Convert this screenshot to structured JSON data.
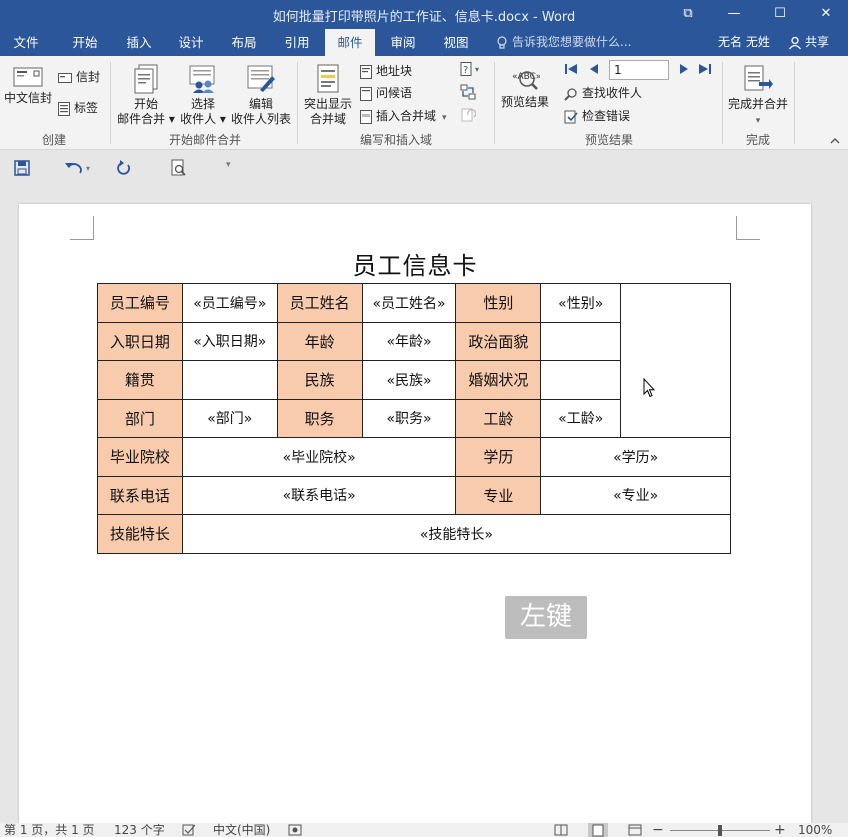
{
  "window": {
    "title": "如何批量打印带照片的工作证、信息卡.docx - Word",
    "controls": {
      "help": "⧉",
      "minimize": "—",
      "maximize": "☐",
      "close": "✕"
    }
  },
  "tabs": [
    {
      "label": "文件"
    },
    {
      "label": "开始"
    },
    {
      "label": "插入"
    },
    {
      "label": "设计"
    },
    {
      "label": "布局"
    },
    {
      "label": "引用"
    },
    {
      "label": "邮件",
      "active": true
    },
    {
      "label": "审阅"
    },
    {
      "label": "视图"
    }
  ],
  "tell_me": "告诉我您想要做什么...",
  "user": "无名 无姓",
  "share": "共享",
  "ribbon": {
    "create": {
      "label": "创建",
      "chinese_envelope": "中文信封",
      "envelope": "信封",
      "labels": "标签"
    },
    "start_merge": {
      "label": "开始邮件合并",
      "start": [
        "开始",
        "邮件合并 ▾"
      ],
      "select": [
        "选择",
        "收件人 ▾"
      ],
      "edit": [
        "编辑",
        "收件人列表"
      ]
    },
    "write_insert": {
      "label": "编写和插入域",
      "highlight": [
        "突出显示",
        "合并域"
      ],
      "address_block": "地址块",
      "greeting": "问候语",
      "insert_field": "插入合并域"
    },
    "preview": {
      "label": "预览结果",
      "preview_results": "预览结果",
      "record": "1",
      "find_recipient": "查找收件人",
      "check_errors": "检查错误"
    },
    "finish": {
      "label": "完成",
      "finish_merge": "完成并合并"
    }
  },
  "document": {
    "title": "员工信息卡",
    "table": {
      "r1": [
        "员工编号",
        "«员工编号»",
        "员工姓名",
        "«员工姓名»",
        "性别",
        "«性别»"
      ],
      "r2": [
        "入职日期",
        "«入职日期»",
        "年龄",
        "«年龄»",
        "政治面貌",
        ""
      ],
      "r3": [
        "籍贯",
        "",
        "民族",
        "«民族»",
        "婚姻状况",
        ""
      ],
      "r4": [
        "部门",
        "«部门»",
        "职务",
        "«职务»",
        "工龄",
        "«工龄»"
      ],
      "r5": [
        "毕业院校",
        "«毕业院校»",
        "学历",
        "«学历»"
      ],
      "r6": [
        "联系电话",
        "«联系电话»",
        "专业",
        "«专业»"
      ],
      "r7": [
        "技能特长",
        "«技能特长»"
      ]
    }
  },
  "overlay_hint": "左键",
  "status": {
    "page": "第 1 页，共 1 页",
    "words": "123 个字",
    "language": "中文(中国)",
    "zoom": "100%"
  },
  "colors": {
    "brand": "#2b579a",
    "label_fill": "#f8cbad"
  }
}
